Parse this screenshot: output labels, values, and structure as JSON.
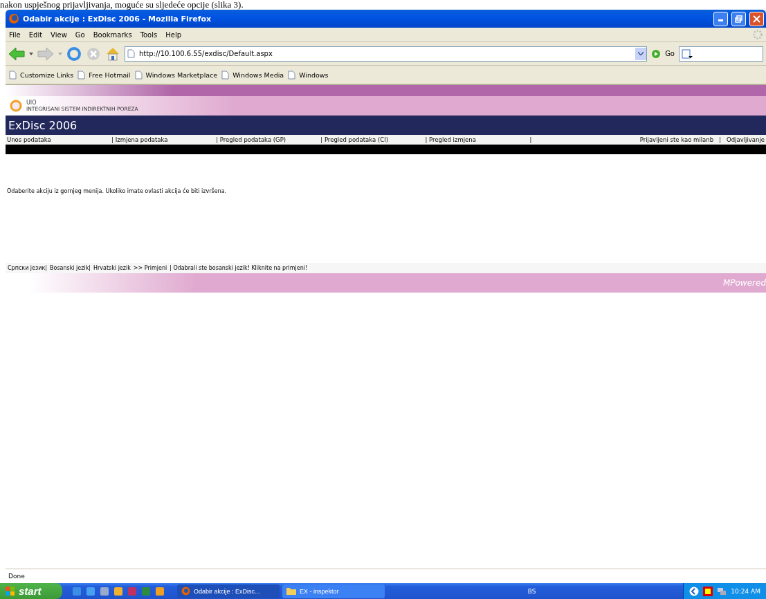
{
  "document_text": "nakon uspješnog prijavljivanja, moguće su sljedeće opcije (slika 3).",
  "window": {
    "title": "Odabir akcije : ExDisc 2006 - Mozilla Firefox"
  },
  "menu": [
    "File",
    "Edit",
    "View",
    "Go",
    "Bookmarks",
    "Tools",
    "Help"
  ],
  "address": {
    "value": "http://10.100.6.55/exdisc/Default.aspx"
  },
  "go_label": "Go",
  "bookmarks": [
    "Customize Links",
    "Free Hotmail",
    "Windows Marketplace",
    "Windows Media",
    "Windows"
  ],
  "page": {
    "org_short": "UIO",
    "org_name": "INTEGRISANI SISTEM INDIREKTNIH POREZA",
    "app_title": "ExDisc 2006",
    "nav": [
      "Unos podataka",
      "| Izmjena podataka",
      "| Pregled podataka (GP)",
      "| Pregled podataka (CI)",
      "| Pregled izmjena",
      "|"
    ],
    "user_links": [
      "Prijavljeni ste kao milanb",
      "|",
      "Odjavljivanje"
    ],
    "message": "Odaberite akciju iz gornjeg menija. Ukoliko imate ovlasti akcija će biti izvršena.",
    "languages": [
      "Српски језик|",
      "Bosanski jezik|",
      "Hrvatski jezik"
    ],
    "apply": ">> Primjeni",
    "notice": "| Odabrali ste bosanski jezik! Kliknite na primjeni!",
    "footer_brand": "MPowered"
  },
  "status": "Done",
  "taskbar": {
    "start": "start",
    "tasks": [
      {
        "label": "Odabir akcije : ExDisc...",
        "selected": true,
        "kind": "browser"
      },
      {
        "label": "EX - inspektor",
        "selected": false,
        "kind": "folder"
      }
    ],
    "language": "BS",
    "clock": "10:24 AM"
  }
}
